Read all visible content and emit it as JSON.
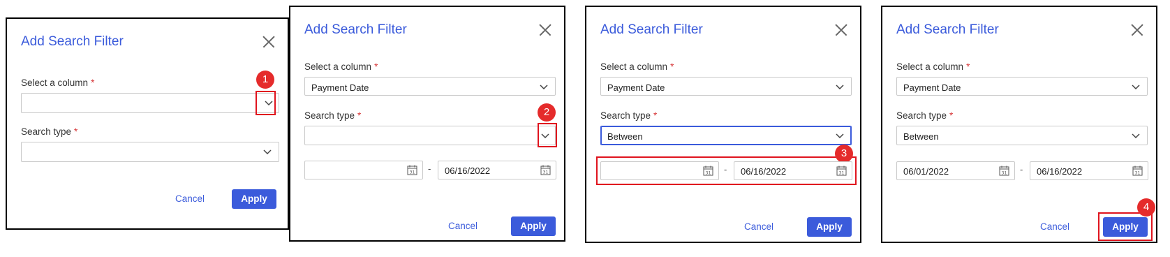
{
  "colors": {
    "accent": "#3b5bdb",
    "required": "#d63638",
    "highlight": "#e0141e",
    "badge": "#e52b2b"
  },
  "icons": {
    "close": "close-icon",
    "dropdown": "chevron-down-icon",
    "calendar": "calendar-icon"
  },
  "steps": [
    {
      "title": "Add Search Filter",
      "column_label": "Select a column",
      "column_value": "",
      "search_type_label": "Search type",
      "search_type_value": "",
      "required_mark": "*",
      "cancel_label": "Cancel",
      "apply_label": "Apply",
      "badge": "1"
    },
    {
      "title": "Add Search Filter",
      "column_label": "Select a column",
      "column_value": "Payment Date",
      "search_type_label": "Search type",
      "search_type_value": "",
      "required_mark": "*",
      "from_date": "",
      "date_separator": "-",
      "to_date": "06/16/2022",
      "cancel_label": "Cancel",
      "apply_label": "Apply",
      "badge": "2"
    },
    {
      "title": "Add Search Filter",
      "column_label": "Select a column",
      "column_value": "Payment Date",
      "search_type_label": "Search type",
      "search_type_value": "Between",
      "required_mark": "*",
      "from_date": "",
      "date_separator": "-",
      "to_date": "06/16/2022",
      "cancel_label": "Cancel",
      "apply_label": "Apply",
      "badge": "3"
    },
    {
      "title": "Add Search Filter",
      "column_label": "Select a column",
      "column_value": "Payment Date",
      "search_type_label": "Search type",
      "search_type_value": "Between",
      "required_mark": "*",
      "from_date": "06/01/2022",
      "date_separator": "-",
      "to_date": "06/16/2022",
      "cancel_label": "Cancel",
      "apply_label": "Apply",
      "badge": "4"
    }
  ]
}
